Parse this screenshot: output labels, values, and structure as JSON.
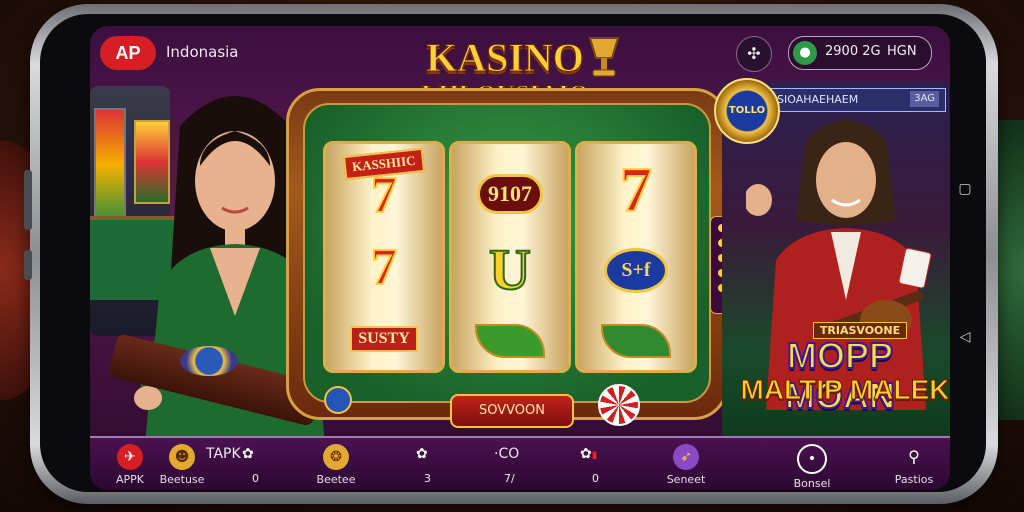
{
  "header": {
    "logo_text": "AP",
    "region": "Indonasia",
    "wallet_balance": "2900 2G",
    "wallet_currency": "HGN"
  },
  "title": {
    "line1": "KASINO",
    "line2": "LHLOUSIAIO"
  },
  "reels": {
    "reel1": [
      "KASSHIIC",
      "7",
      "7",
      "SUSTY"
    ],
    "reel2": [
      "9107",
      "U"
    ],
    "reel3": [
      "7",
      "S+f"
    ]
  },
  "spin_button": "SOVVOON",
  "right_panel": {
    "badge": "TOLLO",
    "sign_text": "SIOAHAEHAEM",
    "sign_number": "3AG",
    "promo_kicker": "TRIASVOONE",
    "promo_line1": "MOPP MOAN",
    "promo_line2": "MALTIP MALEK"
  },
  "bottom_nav": {
    "items": [
      {
        "label": "APPK",
        "icon": "bird-icon"
      },
      {
        "label": "Beetuse",
        "icon": "mascot-icon"
      },
      {
        "label": "Beetee",
        "icon": "tiger-icon"
      },
      {
        "label": "Seneet",
        "icon": "fish-icon"
      },
      {
        "label": "Bonsel",
        "icon": "target-icon"
      },
      {
        "label": "Pastios",
        "icon": "search-icon"
      }
    ],
    "extra_apk": "TAPK",
    "extra_zero": "0",
    "extra_three": "3",
    "extra_co": "·CO",
    "extra_seven": "7/",
    "extra_zero2": "0"
  },
  "colors": {
    "accent_gold": "#f2c443",
    "brand_red": "#d51f24",
    "felt_green": "#19602a"
  }
}
